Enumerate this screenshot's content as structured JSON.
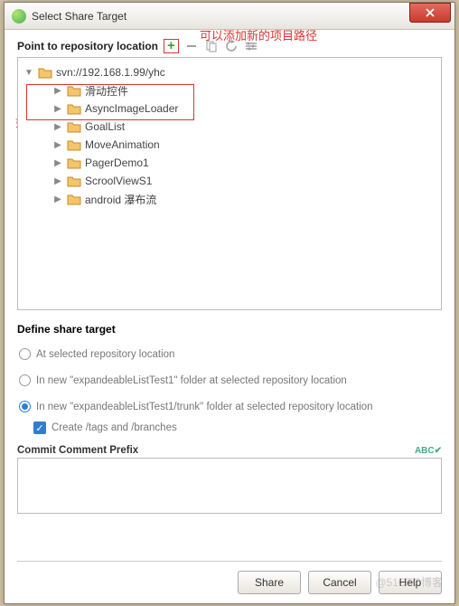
{
  "window": {
    "title": "Select Share Target"
  },
  "annotations": {
    "add_hint": "可以添加新的项目路径",
    "select_hint": "如果有路径直接选择已有的路径"
  },
  "repo": {
    "heading": "Point to repository location",
    "root": "svn://192.168.1.99/yhc",
    "items": [
      "滑动控件",
      "AsyncImageLoader",
      "GoalList",
      "MoveAnimation",
      "PagerDemo1",
      "ScroolViewS1",
      "android 瀑布流"
    ]
  },
  "share": {
    "heading": "Define share target",
    "opt1": "At selected repository location",
    "opt2": "In new \"expandeableListTest1\" folder at selected repository location",
    "opt3": "In new \"expandeableListTest1/trunk\" folder at selected repository location",
    "checkbox": "Create /tags and /branches",
    "selected": 3,
    "checked": true
  },
  "commit": {
    "label": "Commit Comment Prefix",
    "spell": "ABC",
    "value": ""
  },
  "buttons": {
    "share": "Share",
    "cancel": "Cancel",
    "help": "Help"
  },
  "watermark": "@51CTO博客"
}
